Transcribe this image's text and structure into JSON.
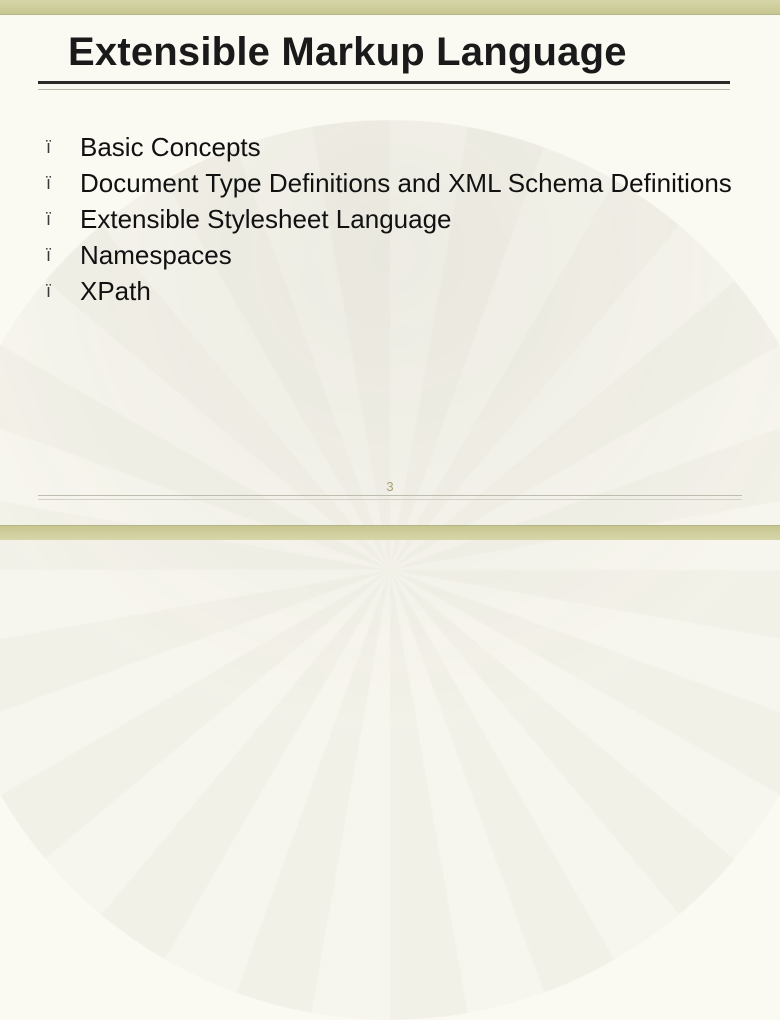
{
  "title": "Extensible Markup Language",
  "bullet_glyph": "ï",
  "items": [
    "Basic Concepts",
    "Document Type Definitions and XML Schema Definitions",
    "Extensible Stylesheet Language",
    "Namespaces",
    "XPath"
  ],
  "page_number": "3"
}
